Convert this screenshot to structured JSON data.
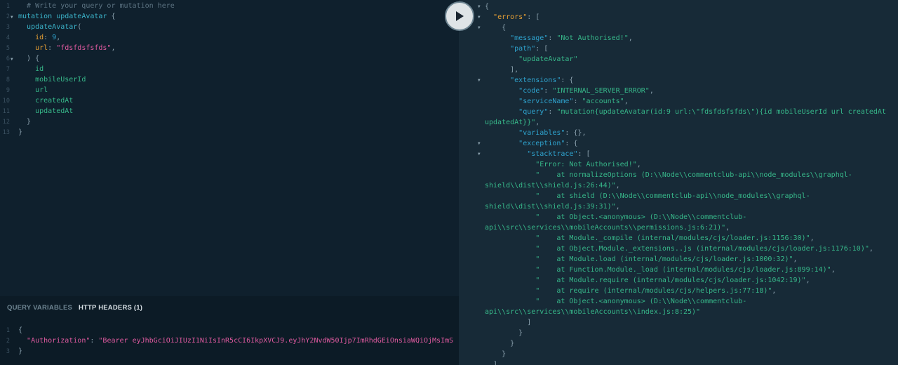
{
  "editor": {
    "lines": [
      {
        "n": "1",
        "fold": "",
        "parts": [
          [
            "cm",
            "  # Write your query or mutation here"
          ]
        ]
      },
      {
        "n": "2",
        "fold": "▼",
        "parts": [
          [
            "kw",
            "mutation"
          ],
          [
            "pun",
            " "
          ],
          [
            "fn",
            "updateAvatar"
          ],
          [
            "pun",
            " {"
          ]
        ]
      },
      {
        "n": "3",
        "fold": "",
        "parts": [
          [
            "pun",
            "  "
          ],
          [
            "fn",
            "updateAvatar"
          ],
          [
            "pun",
            "("
          ]
        ]
      },
      {
        "n": "4",
        "fold": "",
        "parts": [
          [
            "pun",
            "    "
          ],
          [
            "arg",
            "id"
          ],
          [
            "pun",
            ": "
          ],
          [
            "num",
            "9"
          ],
          [
            "pun",
            ","
          ]
        ]
      },
      {
        "n": "5",
        "fold": "",
        "parts": [
          [
            "pun",
            "    "
          ],
          [
            "arg",
            "url"
          ],
          [
            "pun",
            ": "
          ],
          [
            "str",
            "\"fdsfdsfsfds\""
          ],
          [
            "pun",
            ","
          ]
        ]
      },
      {
        "n": "6",
        "fold": "▼",
        "parts": [
          [
            "pun",
            "  ) {"
          ]
        ]
      },
      {
        "n": "7",
        "fold": "",
        "parts": [
          [
            "pun",
            "    "
          ],
          [
            "fld",
            "id"
          ]
        ]
      },
      {
        "n": "8",
        "fold": "",
        "parts": [
          [
            "pun",
            "    "
          ],
          [
            "fld",
            "mobileUserId"
          ]
        ]
      },
      {
        "n": "9",
        "fold": "",
        "parts": [
          [
            "pun",
            "    "
          ],
          [
            "fld",
            "url"
          ]
        ]
      },
      {
        "n": "10",
        "fold": "",
        "parts": [
          [
            "pun",
            "    "
          ],
          [
            "fld",
            "createdAt"
          ]
        ]
      },
      {
        "n": "11",
        "fold": "",
        "parts": [
          [
            "pun",
            "    "
          ],
          [
            "fld",
            "updatedAt"
          ]
        ]
      },
      {
        "n": "12",
        "fold": "",
        "parts": [
          [
            "pun",
            "  }"
          ]
        ]
      },
      {
        "n": "13",
        "fold": "",
        "parts": [
          [
            "pun",
            "}"
          ]
        ]
      }
    ]
  },
  "run_button": {
    "icon": "play-icon"
  },
  "variables_panel": {
    "tabs": [
      {
        "label": "QUERY VARIABLES",
        "active": false
      },
      {
        "label": "HTTP HEADERS (1)",
        "active": true
      }
    ],
    "lines": [
      {
        "n": "1",
        "parts": [
          [
            "pun",
            "{"
          ]
        ]
      },
      {
        "n": "2",
        "parts": [
          [
            "pun",
            "  "
          ],
          [
            "key",
            "\"Authorization\""
          ],
          [
            "pun",
            ": "
          ],
          [
            "hstr",
            "\"Bearer eyJhbGciOiJIUzI1NiIsInR5cCI6IkpXVCJ9.eyJhY2NvdW50Ijp7ImRhdGEiOnsiaWQiOjMsImS"
          ]
        ]
      },
      {
        "n": "3",
        "parts": [
          [
            "pun",
            "}"
          ]
        ]
      }
    ]
  },
  "result": {
    "lines": [
      {
        "f": "▼",
        "parts": [
          [
            "rp",
            "{"
          ]
        ]
      },
      {
        "f": "▼",
        "parts": [
          [
            "rp",
            "  "
          ],
          [
            "rerr",
            "\"errors\""
          ],
          [
            "rp",
            ": ["
          ]
        ]
      },
      {
        "f": "▼",
        "parts": [
          [
            "rp",
            "    {"
          ]
        ]
      },
      {
        "f": "",
        "parts": [
          [
            "rp",
            "      "
          ],
          [
            "rk",
            "\"message\""
          ],
          [
            "rp",
            ": "
          ],
          [
            "rs",
            "\"Not Authorised!\""
          ],
          [
            "rp",
            ","
          ]
        ]
      },
      {
        "f": "",
        "parts": [
          [
            "rp",
            "      "
          ],
          [
            "rk",
            "\"path\""
          ],
          [
            "rp",
            ": ["
          ]
        ]
      },
      {
        "f": "",
        "parts": [
          [
            "rp",
            "        "
          ],
          [
            "rs",
            "\"updateAvatar\""
          ]
        ]
      },
      {
        "f": "",
        "parts": [
          [
            "rp",
            "      ],"
          ]
        ]
      },
      {
        "f": "▼",
        "parts": [
          [
            "rp",
            "      "
          ],
          [
            "rk",
            "\"extensions\""
          ],
          [
            "rp",
            ": {"
          ]
        ]
      },
      {
        "f": "",
        "parts": [
          [
            "rp",
            "        "
          ],
          [
            "rk",
            "\"code\""
          ],
          [
            "rp",
            ": "
          ],
          [
            "rs",
            "\"INTERNAL_SERVER_ERROR\""
          ],
          [
            "rp",
            ","
          ]
        ]
      },
      {
        "f": "",
        "parts": [
          [
            "rp",
            "        "
          ],
          [
            "rk",
            "\"serviceName\""
          ],
          [
            "rp",
            ": "
          ],
          [
            "rs",
            "\"accounts\""
          ],
          [
            "rp",
            ","
          ]
        ]
      },
      {
        "f": "",
        "parts": [
          [
            "rp",
            "        "
          ],
          [
            "rk",
            "\"query\""
          ],
          [
            "rp",
            ": "
          ],
          [
            "rs",
            "\"mutation{updateAvatar(id:9 url:\\\"fdsfdsfsfds\\\"){id mobileUserId url createdAt"
          ]
        ]
      },
      {
        "f": "",
        "parts": [
          [
            "rs",
            "updatedAt}}\""
          ],
          [
            "rp",
            ","
          ]
        ]
      },
      {
        "f": "",
        "parts": [
          [
            "rp",
            "        "
          ],
          [
            "rk",
            "\"variables\""
          ],
          [
            "rp",
            ": {},"
          ]
        ]
      },
      {
        "f": "▼",
        "parts": [
          [
            "rp",
            "        "
          ],
          [
            "rk",
            "\"exception\""
          ],
          [
            "rp",
            ": {"
          ]
        ]
      },
      {
        "f": "▼",
        "parts": [
          [
            "rp",
            "          "
          ],
          [
            "rk",
            "\"stacktrace\""
          ],
          [
            "rp",
            ": ["
          ]
        ]
      },
      {
        "f": "",
        "parts": [
          [
            "rp",
            "            "
          ],
          [
            "rs",
            "\"Error: Not Authorised!\""
          ],
          [
            "rp",
            ","
          ]
        ]
      },
      {
        "f": "",
        "parts": [
          [
            "rp",
            "            "
          ],
          [
            "rs",
            "\"    at normalizeOptions (D:\\\\Node\\\\commentclub-api\\\\node_modules\\\\graphql-"
          ]
        ]
      },
      {
        "f": "",
        "parts": [
          [
            "rs",
            "shield\\\\dist\\\\shield.js:26:44)\""
          ],
          [
            "rp",
            ","
          ]
        ]
      },
      {
        "f": "",
        "parts": [
          [
            "rp",
            "            "
          ],
          [
            "rs",
            "\"    at shield (D:\\\\Node\\\\commentclub-api\\\\node_modules\\\\graphql-"
          ]
        ]
      },
      {
        "f": "",
        "parts": [
          [
            "rs",
            "shield\\\\dist\\\\shield.js:39:31)\""
          ],
          [
            "rp",
            ","
          ]
        ]
      },
      {
        "f": "",
        "parts": [
          [
            "rp",
            "            "
          ],
          [
            "rs",
            "\"    at Object.<anonymous> (D:\\\\Node\\\\commentclub-"
          ]
        ]
      },
      {
        "f": "",
        "parts": [
          [
            "rs",
            "api\\\\src\\\\services\\\\mobileAccounts\\\\permissions.js:6:21)\""
          ],
          [
            "rp",
            ","
          ]
        ]
      },
      {
        "f": "",
        "parts": [
          [
            "rp",
            "            "
          ],
          [
            "rs",
            "\"    at Module._compile (internal/modules/cjs/loader.js:1156:30)\""
          ],
          [
            "rp",
            ","
          ]
        ]
      },
      {
        "f": "",
        "parts": [
          [
            "rp",
            "            "
          ],
          [
            "rs",
            "\"    at Object.Module._extensions..js (internal/modules/cjs/loader.js:1176:10)\""
          ],
          [
            "rp",
            ","
          ]
        ]
      },
      {
        "f": "",
        "parts": [
          [
            "rp",
            "            "
          ],
          [
            "rs",
            "\"    at Module.load (internal/modules/cjs/loader.js:1000:32)\""
          ],
          [
            "rp",
            ","
          ]
        ]
      },
      {
        "f": "",
        "parts": [
          [
            "rp",
            "            "
          ],
          [
            "rs",
            "\"    at Function.Module._load (internal/modules/cjs/loader.js:899:14)\""
          ],
          [
            "rp",
            ","
          ]
        ]
      },
      {
        "f": "",
        "parts": [
          [
            "rp",
            "            "
          ],
          [
            "rs",
            "\"    at Module.require (internal/modules/cjs/loader.js:1042:19)\""
          ],
          [
            "rp",
            ","
          ]
        ]
      },
      {
        "f": "",
        "parts": [
          [
            "rp",
            "            "
          ],
          [
            "rs",
            "\"    at require (internal/modules/cjs/helpers.js:77:18)\""
          ],
          [
            "rp",
            ","
          ]
        ]
      },
      {
        "f": "",
        "parts": [
          [
            "rp",
            "            "
          ],
          [
            "rs",
            "\"    at Object.<anonymous> (D:\\\\Node\\\\commentclub-"
          ]
        ]
      },
      {
        "f": "",
        "parts": [
          [
            "rs",
            "api\\\\src\\\\services\\\\mobileAccounts\\\\index.js:8:25)\""
          ]
        ]
      },
      {
        "f": "",
        "parts": [
          [
            "rp",
            "          ]"
          ]
        ]
      },
      {
        "f": "",
        "parts": [
          [
            "rp",
            "        }"
          ]
        ]
      },
      {
        "f": "",
        "parts": [
          [
            "rp",
            "      }"
          ]
        ]
      },
      {
        "f": "",
        "parts": [
          [
            "rp",
            "    }"
          ]
        ]
      },
      {
        "f": "",
        "parts": [
          [
            "rp",
            "  ]"
          ]
        ]
      }
    ]
  }
}
